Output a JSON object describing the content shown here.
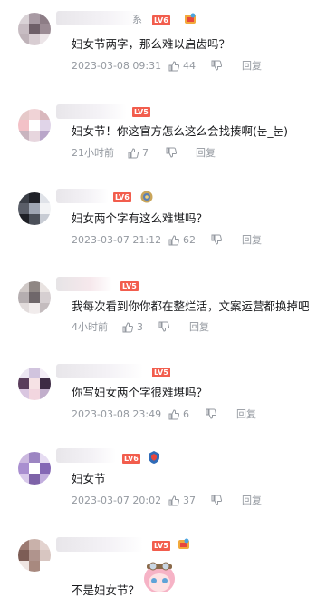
{
  "comments": [
    {
      "name_suffix": "系",
      "level": "LV6",
      "content": "妇女节两字，那么难以启齿吗？",
      "time": "2023-03-08 09:31",
      "likes": "44",
      "reply": "回复",
      "avatar_colors": [
        "#d9d2d6",
        "#a89aa3",
        "#8d7d86",
        "#c7bcc2",
        "#6e5f68",
        "#9b8b94",
        "#bfb3b9",
        "#d8cdd2",
        "#ece5e8"
      ]
    },
    {
      "name_suffix": "",
      "level": "LV5",
      "content": "妇女节！你这官方怎么这么会找揍啊(눈_눈)",
      "time": "21小时前",
      "likes": "7",
      "reply": "回复",
      "avatar_colors": [
        "#e6c9c9",
        "#f0d3d6",
        "#d9b8bd",
        "#f3c1c7",
        "#ffffff",
        "#e0d4e8",
        "#c9b4bf",
        "#e7d6de",
        "#b9a6c9"
      ]
    },
    {
      "name_suffix": "",
      "level": "LV6",
      "content": "妇女两个字有这么难堪吗？",
      "time": "2023-03-07 21:12",
      "likes": "62",
      "reply": "回复",
      "avatar_colors": [
        "#3b3f47",
        "#202228",
        "#dfe2e8",
        "#5a5e68",
        "#9fa6b3",
        "#f2f3f5",
        "#1e2026",
        "#4b5059",
        "#c8ccd4"
      ]
    },
    {
      "name_suffix": "",
      "level": "LV5",
      "content": "我每次看到你你都在整烂活，文案运营都换掉吧",
      "time": "4小时前",
      "likes": "3",
      "reply": "回复",
      "avatar_colors": [
        "#cfc8c6",
        "#8f8784",
        "#e9e3e1",
        "#b5aeb0",
        "#6f676a",
        "#d6cfd1",
        "#e2dcdc",
        "#f1ecec",
        "#c4bcbe"
      ]
    },
    {
      "name_suffix": "",
      "level": "LV5",
      "content": "你写妇女两个字很难堪吗？",
      "time": "2023-03-08 23:49",
      "likes": "6",
      "reply": "回复",
      "avatar_colors": [
        "#ece6f2",
        "#d1c4de",
        "#f4eef7",
        "#5a3d5c",
        "#f6e2e5",
        "#3e2b45",
        "#d9c6e0",
        "#f2d6df",
        "#c1aecb"
      ]
    },
    {
      "name_suffix": "",
      "level": "LV6",
      "content": "妇女节",
      "time": "2023-03-07 20:02",
      "likes": "37",
      "reply": "回复",
      "avatar_colors": [
        "#cbb8df",
        "#9c85c2",
        "#e6dcf2",
        "#a98fd0",
        "#ffffff",
        "#8467b5",
        "#d8c9ea",
        "#7e63a8",
        "#c2aede"
      ]
    },
    {
      "name_suffix": "",
      "level": "LV5",
      "content": "不是妇女节？",
      "time": "",
      "likes": "",
      "reply": "",
      "avatar_colors": [
        "#9c7a72",
        "#c9b1aa",
        "#e3d3cf",
        "#7d5d56",
        "#b0948d",
        "#d8c6c1",
        "#efe5e2",
        "#a8897f",
        "#ffffff"
      ]
    }
  ],
  "icons": {
    "like": "thumbs-up-icon",
    "dislike": "thumbs-down-icon",
    "medal": "fan-medal-icon"
  },
  "colors": {
    "level_badge": "#f25d4d",
    "meta_text": "#9499a0",
    "content_text": "#18191c"
  }
}
